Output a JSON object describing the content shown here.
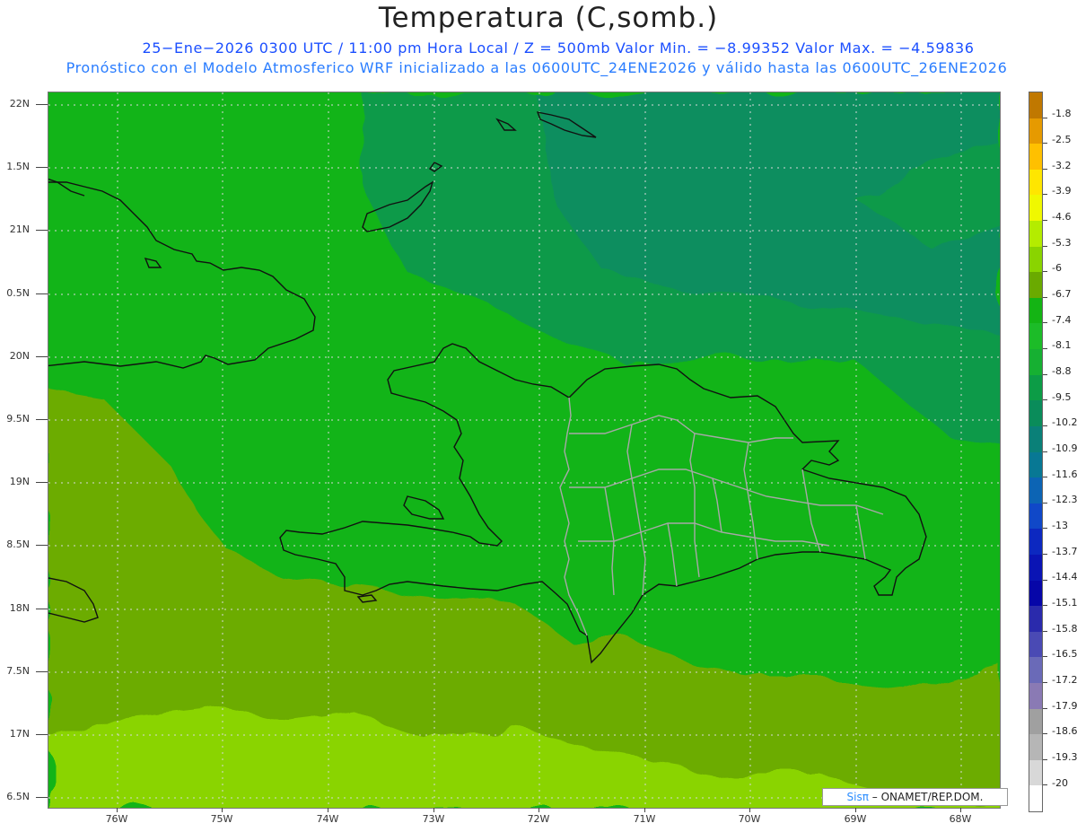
{
  "title": "Temperatura (C,somb.)",
  "subtitle1": "25−Ene−2026  0300 UTC / 11:00 pm Hora Local / Z = 500mb  Valor Min. = −8.99352  Valor Max. = −4.59836",
  "subtitle2": "Pronóstico con el Modelo Atmosferico WRF inicializado a las 0600UTC_24ENE2026 y válido hasta las  0600UTC_26ENE2026",
  "lat_labels": [
    "22N",
    "1.5N",
    "21N",
    "0.5N",
    "20N",
    "9.5N",
    "19N",
    "8.5N",
    "18N",
    "7.5N",
    "17N",
    "6.5N"
  ],
  "lon_labels": [
    "76W",
    "75W",
    "74W",
    "73W",
    "72W",
    "71W",
    "70W",
    "69W",
    "68W"
  ],
  "colorbar": {
    "labels": [
      "-1.8",
      "-2.5",
      "-3.2",
      "-3.9",
      "-4.6",
      "-5.3",
      "-6",
      "-6.7",
      "-7.4",
      "-8.1",
      "-8.8",
      "-9.5",
      "-10.2",
      "-10.9",
      "-11.6",
      "-12.3",
      "-13",
      "-13.7",
      "-14.4",
      "-15.1",
      "-15.8",
      "-16.5",
      "-17.2",
      "-17.9",
      "-18.6",
      "-19.3",
      "-20"
    ],
    "colors": [
      "#c07800",
      "#e69a00",
      "#ffc000",
      "#ffe600",
      "#f0f800",
      "#b4ec00",
      "#8ad400",
      "#6aaa00",
      "#14b414",
      "#1cbc28",
      "#16b032",
      "#0c9c46",
      "#0a8c5a",
      "#0a8078",
      "#087894",
      "#0c64b4",
      "#1048c8",
      "#0c28c0",
      "#0a14b4",
      "#0606a8",
      "#2a2aac",
      "#4a4ab4",
      "#6a6ab8",
      "#8a7ab4",
      "#a0a0a0",
      "#b6b6b6",
      "#d8d8d8",
      "#ffffff"
    ]
  },
  "credit": {
    "brand": "Sisπ",
    "text": "–  ONAMET/REP.DOM."
  }
}
